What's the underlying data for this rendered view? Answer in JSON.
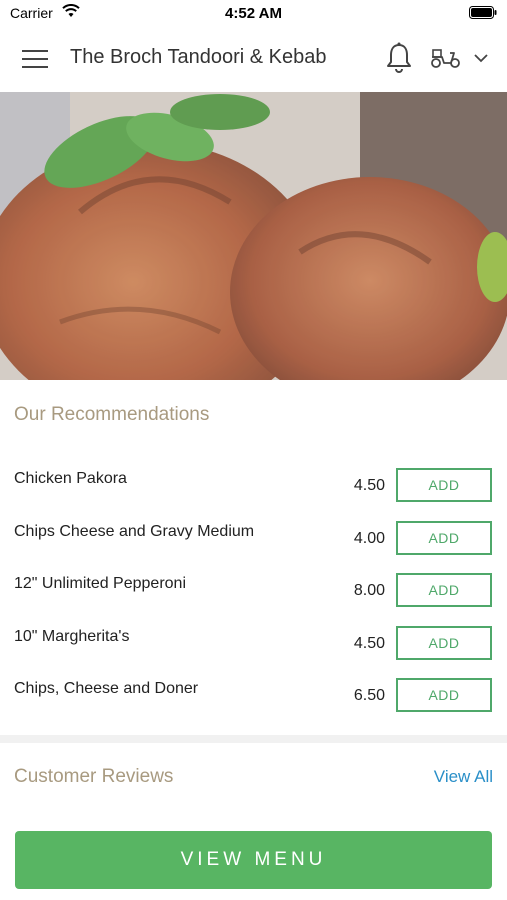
{
  "status_bar": {
    "carrier": "Carrier",
    "time": "4:52 AM"
  },
  "header": {
    "title": "The Broch Tandoori & Kebab"
  },
  "recommendations": {
    "title": "Our Recommendations",
    "add_label": "ADD",
    "items": [
      {
        "name": "Chicken Pakora",
        "price": "4.50"
      },
      {
        "name": "Chips Cheese and Gravy Medium",
        "price": "4.00"
      },
      {
        "name": "12\" Unlimited Pepperoni",
        "price": "8.00"
      },
      {
        "name": "10\" Margherita's",
        "price": "4.50"
      },
      {
        "name": "Chips, Cheese and Doner",
        "price": "6.50"
      }
    ]
  },
  "reviews": {
    "title": "Customer Reviews",
    "view_all": "View All"
  },
  "footer": {
    "view_menu": "VIEW MENU"
  },
  "colors": {
    "accent_green": "#58b563",
    "link_blue": "#2a8fc8",
    "heading_tan": "#a89a80"
  }
}
